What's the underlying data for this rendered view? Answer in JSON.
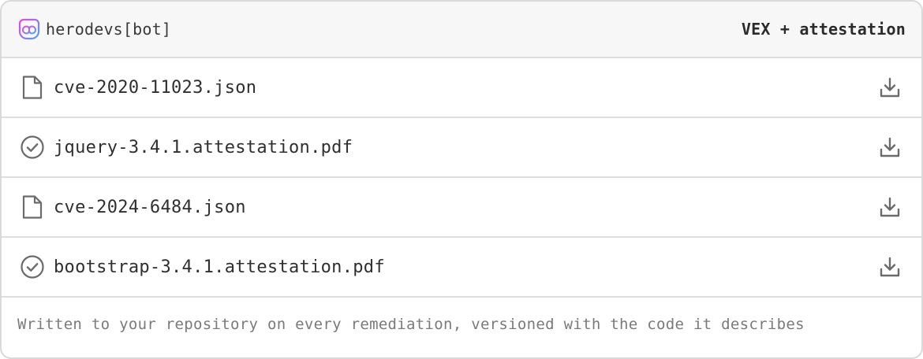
{
  "header": {
    "brand_name": "herodevs[bot]",
    "brand_icon": "herodevs-logo-icon",
    "title": "VEX + attestation"
  },
  "files": [
    {
      "name": "cve-2020-11023.json",
      "icon": "file-icon"
    },
    {
      "name": "jquery-3.4.1.attestation.pdf",
      "icon": "check-circle-icon"
    },
    {
      "name": "cve-2024-6484.json",
      "icon": "file-icon"
    },
    {
      "name": "bootstrap-3.4.1.attestation.pdf",
      "icon": "check-circle-icon"
    }
  ],
  "download_icon": "download-icon",
  "footer": {
    "text": "Written to your repository on every remediation, versioned with the code it describes"
  },
  "colors": {
    "brand_gradient_start": "#e84ad8",
    "brand_gradient_end": "#4aa3f0",
    "icon_gray": "#6b6b6b",
    "border": "#dedede",
    "header_bg": "#f7f7f7"
  }
}
